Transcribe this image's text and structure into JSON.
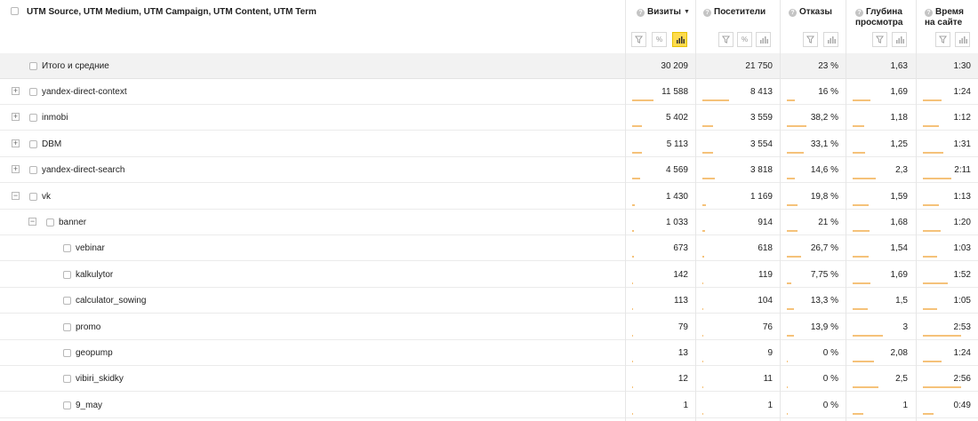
{
  "header": {
    "dimension_title": "UTM Source, UTM Medium, UTM Campaign, UTM Content, UTM Term",
    "metrics": [
      {
        "line1": "Визиты",
        "line2": "",
        "sorted": true,
        "sort_glyph": "▼"
      },
      {
        "line1": "Посетители",
        "line2": ""
      },
      {
        "line1": "Отказы",
        "line2": ""
      },
      {
        "line1": "Глубина",
        "line2": "просмотра"
      },
      {
        "line1": "Время",
        "line2": "на сайте"
      }
    ],
    "help_glyph": "?",
    "filter_icon": "funnel-icon",
    "percent_icon": "percent-icon",
    "chart_icon": "bar-chart-icon",
    "percent_label": "%",
    "accent": "#ffdb4d"
  },
  "total": {
    "label": "Итого и средние",
    "values": [
      "30 209",
      "21 750",
      "23 %",
      "1,63",
      "1:30"
    ]
  },
  "rows": [
    {
      "label": "yandex-direct-context",
      "level": 0,
      "expander": "+",
      "values": [
        "11 588",
        "8 413",
        "16 %",
        "1,69",
        "1:24"
      ],
      "bars": [
        0.38,
        0.39,
        0.16,
        0.32,
        0.39
      ]
    },
    {
      "label": "inmobi",
      "level": 0,
      "expander": "+",
      "values": [
        "5 402",
        "3 559",
        "38,2 %",
        "1,18",
        "1:12"
      ],
      "bars": [
        0.18,
        0.16,
        0.38,
        0.22,
        0.33
      ]
    },
    {
      "label": "DBM",
      "level": 0,
      "expander": "+",
      "values": [
        "5 113",
        "3 554",
        "33,1 %",
        "1,25",
        "1:31"
      ],
      "bars": [
        0.17,
        0.16,
        0.33,
        0.23,
        0.42
      ]
    },
    {
      "label": "yandex-direct-search",
      "level": 0,
      "expander": "+",
      "values": [
        "4 569",
        "3 818",
        "14,6 %",
        "2,3",
        "2:11"
      ],
      "bars": [
        0.15,
        0.18,
        0.15,
        0.43,
        0.6
      ]
    },
    {
      "label": "vk",
      "level": 0,
      "expander": "−",
      "values": [
        "1 430",
        "1 169",
        "19,8 %",
        "1,59",
        "1:13"
      ],
      "bars": [
        0.05,
        0.05,
        0.2,
        0.3,
        0.33
      ]
    },
    {
      "label": "banner",
      "level": 1,
      "expander": "−",
      "values": [
        "1 033",
        "914",
        "21 %",
        "1,68",
        "1:20"
      ],
      "bars": [
        0.04,
        0.04,
        0.21,
        0.31,
        0.37
      ]
    },
    {
      "label": "vebinar",
      "level": 2,
      "expander": "",
      "values": [
        "673",
        "618",
        "26,7 %",
        "1,54",
        "1:03"
      ],
      "bars": [
        0.025,
        0.03,
        0.27,
        0.29,
        0.29
      ]
    },
    {
      "label": "kalkulytor",
      "level": 2,
      "expander": "",
      "values": [
        "142",
        "119",
        "7,75 %",
        "1,69",
        "1:52"
      ],
      "bars": [
        0.01,
        0.01,
        0.08,
        0.32,
        0.51
      ]
    },
    {
      "label": "calculator_sowing",
      "level": 2,
      "expander": "",
      "values": [
        "113",
        "104",
        "13,3 %",
        "1,5",
        "1:05"
      ],
      "bars": [
        0.01,
        0.01,
        0.13,
        0.28,
        0.3
      ]
    },
    {
      "label": "promo",
      "level": 2,
      "expander": "",
      "values": [
        "79",
        "76",
        "13,9 %",
        "3",
        "2:53"
      ],
      "bars": [
        0.005,
        0.005,
        0.14,
        0.56,
        0.79
      ]
    },
    {
      "label": "geopump",
      "level": 2,
      "expander": "",
      "values": [
        "13",
        "9",
        "0 %",
        "2,08",
        "1:24"
      ],
      "bars": [
        0.002,
        0.002,
        0.0,
        0.39,
        0.38
      ]
    },
    {
      "label": "vibiri_skidky",
      "level": 2,
      "expander": "",
      "values": [
        "12",
        "11",
        "0 %",
        "2,5",
        "2:56"
      ],
      "bars": [
        0.002,
        0.002,
        0.0,
        0.47,
        0.8
      ]
    },
    {
      "label": "9_may",
      "level": 2,
      "expander": "",
      "values": [
        "1",
        "1",
        "0 %",
        "1",
        "0:49"
      ],
      "bars": [
        0.001,
        0.001,
        0.0,
        0.19,
        0.22
      ]
    }
  ]
}
